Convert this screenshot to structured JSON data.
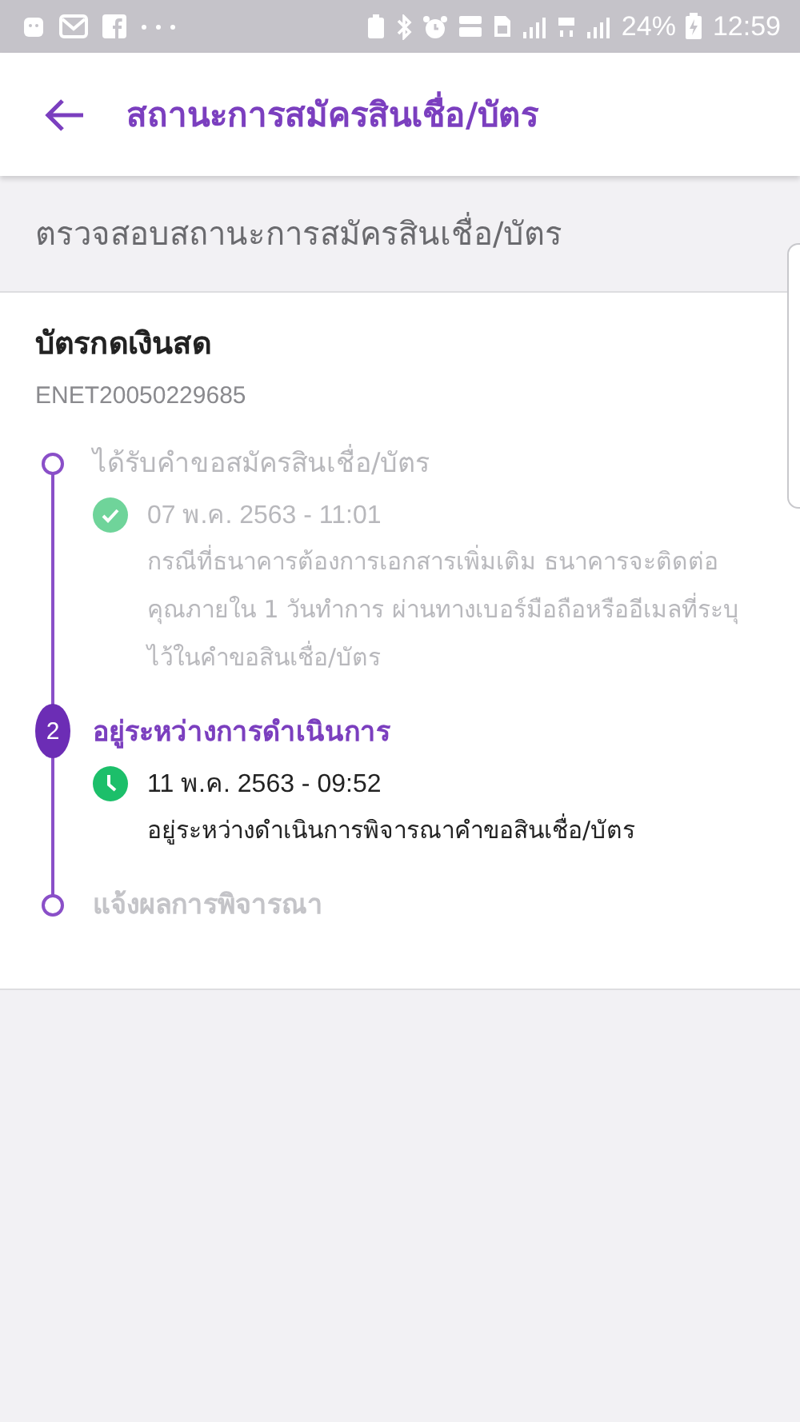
{
  "status_bar": {
    "battery": "24%",
    "time": "12:59"
  },
  "app_bar": {
    "title": "สถานะการสมัครสินเชื่อ/บัตร"
  },
  "section_header": "ตรวจสอบสถานะการสมัครสินเชื่อ/บัตร",
  "card": {
    "title": "บัตรกดเงินสด",
    "reference": "ENET20050229685",
    "steps": [
      {
        "kind": "done",
        "title": "ได้รับคำขอสมัครสินเชื่อ/บัตร",
        "time": "07 พ.ค. 2563 - 11:01",
        "description": "กรณีที่ธนาคารต้องการเอกสารเพิ่มเติม ธนาคารจะติดต่อคุณภายใน 1 วันทำการ ผ่านทางเบอร์มือถือหรืออีเมลที่ระบุไว้ในคำขอสินเชื่อ/บัตร"
      },
      {
        "kind": "current",
        "number": "2",
        "title": "อยู่ระหว่างการดำเนินการ",
        "time": "11 พ.ค. 2563 - 09:52",
        "description": "อยู่ระหว่างดำเนินการพิจารณาคำขอสินเชื่อ/บัตร"
      },
      {
        "kind": "pending",
        "title": "แจ้งผลการพิจารณา"
      }
    ]
  }
}
